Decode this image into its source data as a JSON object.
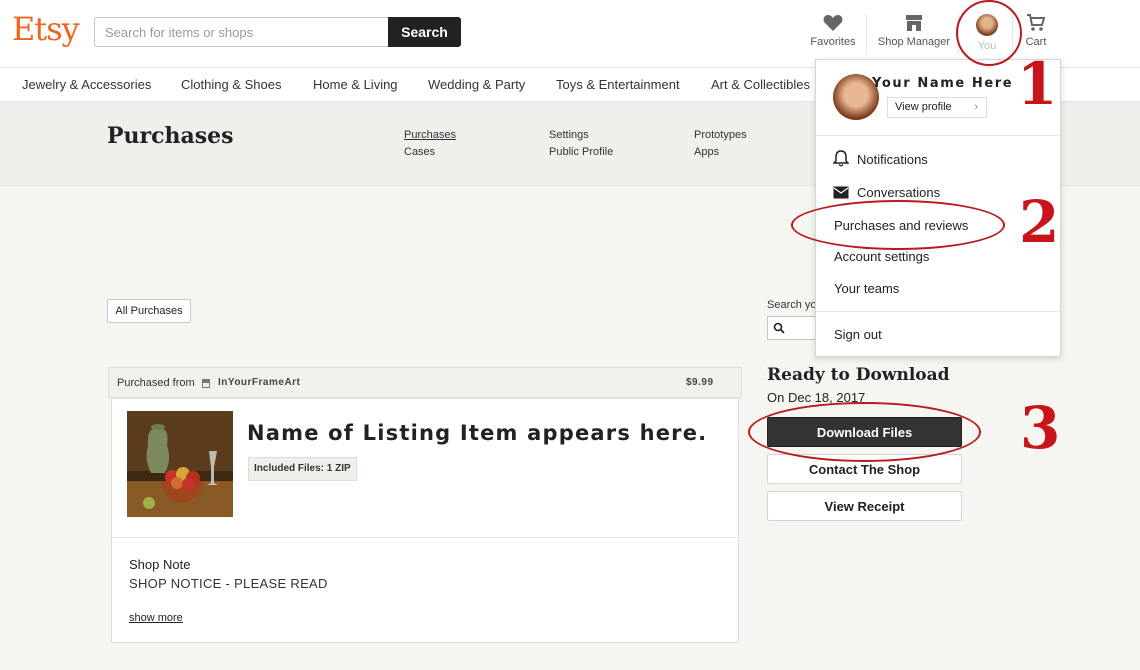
{
  "brand": {
    "logo": "Etsy",
    "accent": "#F1641E"
  },
  "search": {
    "placeholder": "Search for items or shops",
    "button": "Search"
  },
  "header_nav": {
    "favorites": "Favorites",
    "shop_manager": "Shop Manager",
    "you": "You",
    "cart": "Cart"
  },
  "categories": [
    "Jewelry & Accessories",
    "Clothing & Shoes",
    "Home & Living",
    "Wedding & Party",
    "Toys & Entertainment",
    "Art & Collectibles"
  ],
  "subheader": {
    "title": "Purchases",
    "links": [
      "Purchases",
      "Cases",
      "Settings",
      "Public Profile",
      "Prototypes",
      "Apps"
    ]
  },
  "filter": {
    "all_purchases": "All Purchases"
  },
  "order": {
    "purchased_from_label": "Purchased from",
    "shop_name": "InYourFrameArt",
    "price": "$9.99",
    "item_title": "Name of Listing Item appears here.",
    "included_files": "Included Files: 1 ZIP",
    "shop_note_label": "Shop Note",
    "shop_note_text": "SHOP NOTICE - PLEASE READ",
    "show_more": "show more"
  },
  "right_panel": {
    "search_label": "Search yo",
    "ready_title": "Ready to Download",
    "date": "On Dec 18, 2017",
    "download": "Download Files",
    "contact": "Contact The Shop",
    "receipt": "View Receipt"
  },
  "dropdown": {
    "name": "Your Name Here",
    "view_profile": "View profile",
    "items": [
      "Notifications",
      "Conversations",
      "Purchases and reviews",
      "Account settings",
      "Your teams"
    ],
    "sign_out": "Sign out"
  },
  "annotations": {
    "n1": "1",
    "n2": "2",
    "n3": "3",
    "color": "#c8151b"
  }
}
